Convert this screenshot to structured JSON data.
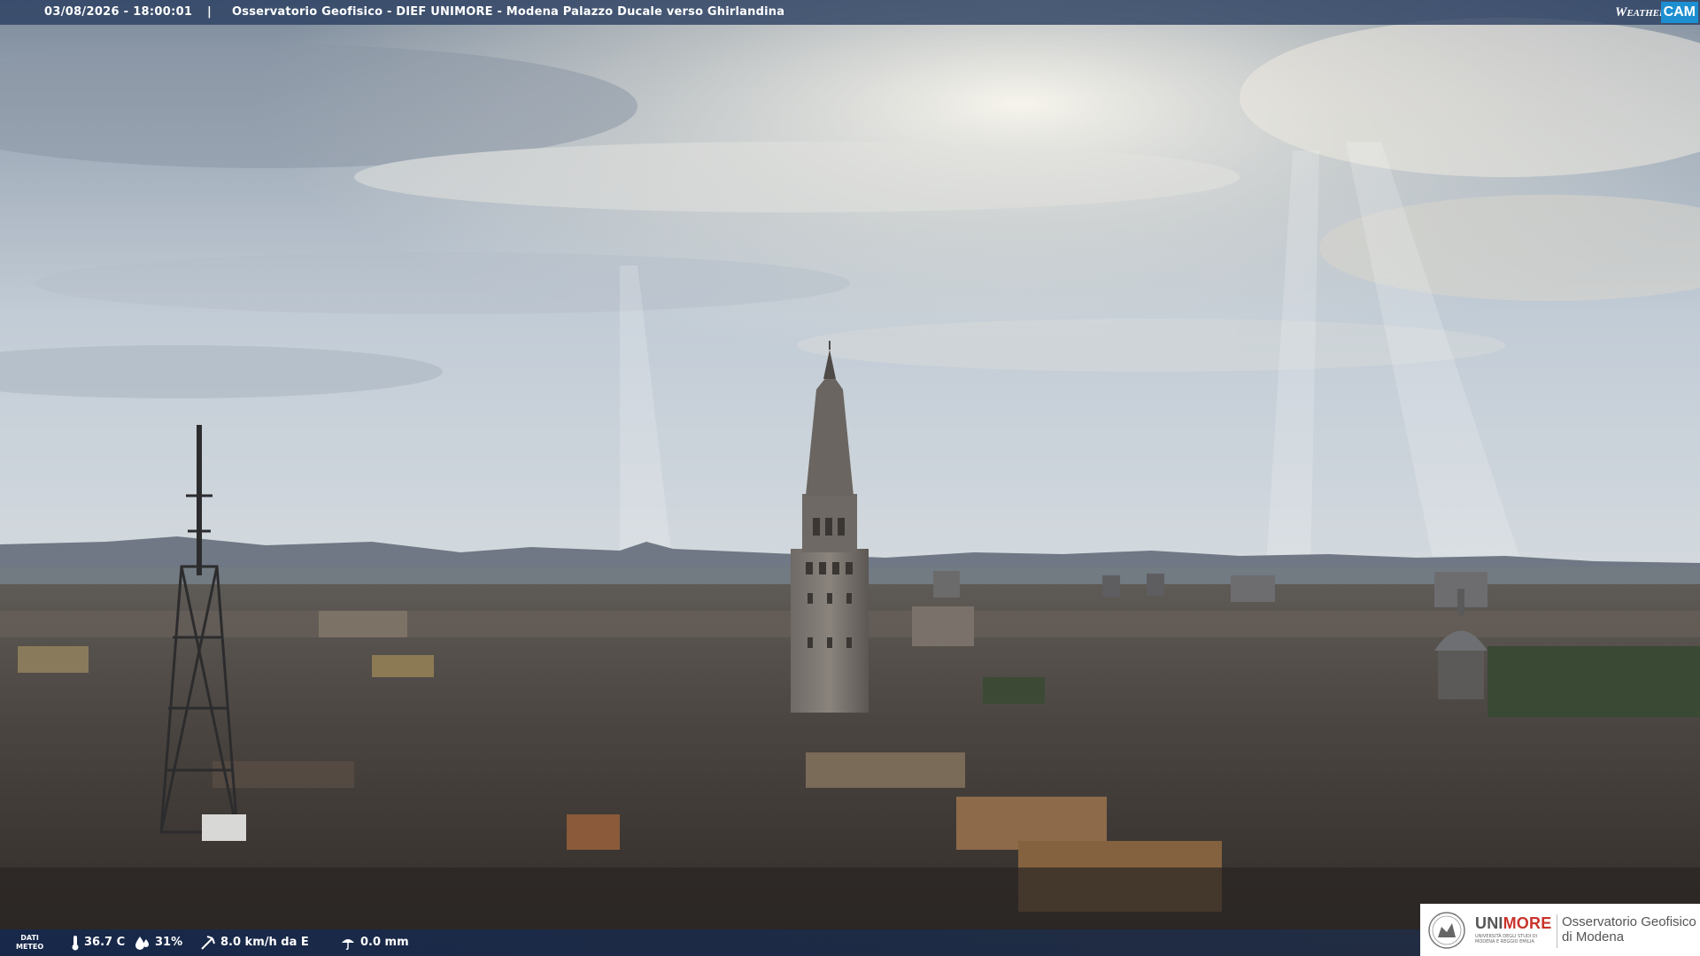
{
  "header": {
    "datetime": "03/08/2026 - 18:00:01",
    "separator": "|",
    "title": "Osservatorio Geofisico - DIEF UNIMORE - Modena Palazzo Ducale verso Ghirlandina",
    "brand_weather": "Weather",
    "brand_cam": "CAM"
  },
  "weather": {
    "label_line1": "DATI",
    "label_line2": "METEO",
    "temperature": "36.7 C",
    "humidity": "31%",
    "wind": "8.0 km/h da E",
    "rain": "0.0 mm",
    "icons": [
      "thermometer-icon",
      "humidity-drop-icon",
      "wind-icon",
      "rain-icon"
    ]
  },
  "logo": {
    "uni": "UNI",
    "more": "MORE",
    "subtitle": "UNIVERSITÀ DEGLI STUDI DI MODENA E REGGIO EMILIA",
    "observatory_line1": "Osservatorio Geofisico",
    "observatory_line2": "di Modena"
  },
  "colors": {
    "topbar": "#283c5f",
    "brand_accent": "#1d8fd0",
    "unimore_red": "#c8342c"
  }
}
